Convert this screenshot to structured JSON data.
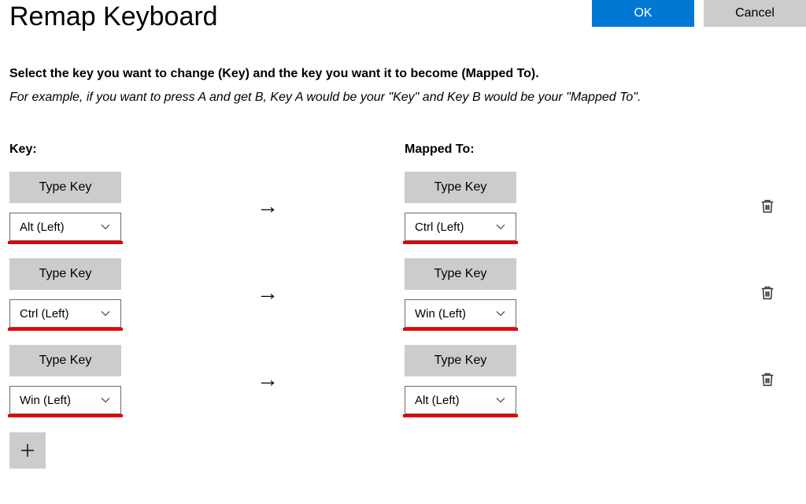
{
  "header": {
    "title": "Remap Keyboard",
    "ok_label": "OK",
    "cancel_label": "Cancel"
  },
  "instructions": {
    "bold": "Select the key you want to change (Key) and the key you want it to become (Mapped To).",
    "italic": "For example, if you want to press A and get B, Key A would be your \"Key\" and Key B would be your \"Mapped To\"."
  },
  "columns": {
    "key": "Key:",
    "mapped": "Mapped To:"
  },
  "type_key_label": "Type Key",
  "rows": [
    {
      "key": "Alt (Left)",
      "mapped": "Ctrl (Left)"
    },
    {
      "key": "Ctrl (Left)",
      "mapped": "Win (Left)"
    },
    {
      "key": "Win (Left)",
      "mapped": "Alt (Left)"
    }
  ]
}
